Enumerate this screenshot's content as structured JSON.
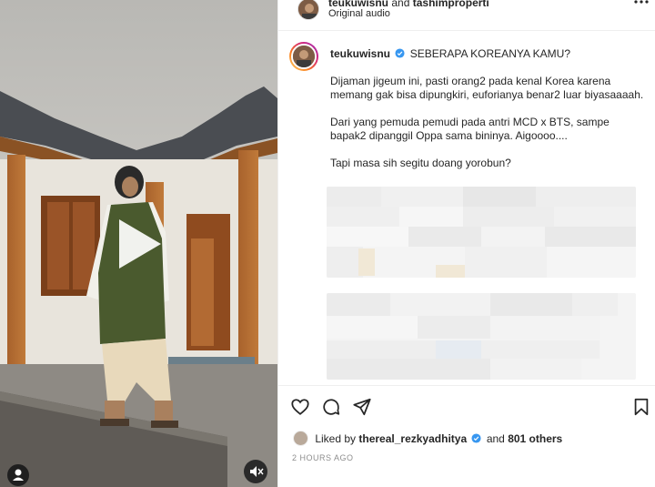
{
  "header": {
    "author": "teukuwisnu",
    "conjunction": "and",
    "collaborator": "tashimproperti",
    "audio": "Original audio"
  },
  "caption": {
    "username": "teukuwisnu",
    "headline": "SEBERAPA KOREANYA KAMU?",
    "paragraphs": [
      "Dijaman jigeum ini, pasti orang2 pada kenal Korea karena memang gak bisa dipungkiri, euforianya benar2 luar biyasaaaah.",
      "Dari yang pemuda pemudi pada antri MCD x BTS, sampe bapak2 dipanggil Oppa sama bininya. Aigoooo....",
      "Tapi masa sih segitu doang yorobun?"
    ]
  },
  "likes": {
    "prefix": "Liked by",
    "user": "thereal_rezkyadhitya",
    "conjunction": "and",
    "others": "801 others"
  },
  "timestamp": "2 HOURS AGO",
  "icons": [
    "more-icon",
    "verified-icon",
    "heart-icon",
    "comment-icon",
    "share-icon",
    "bookmark-icon",
    "play-icon",
    "mute-icon",
    "user-icon"
  ],
  "colors": {
    "verified": "#3897f0",
    "text": "#262626",
    "muted": "#8e8e8e",
    "border": "#efefef"
  }
}
